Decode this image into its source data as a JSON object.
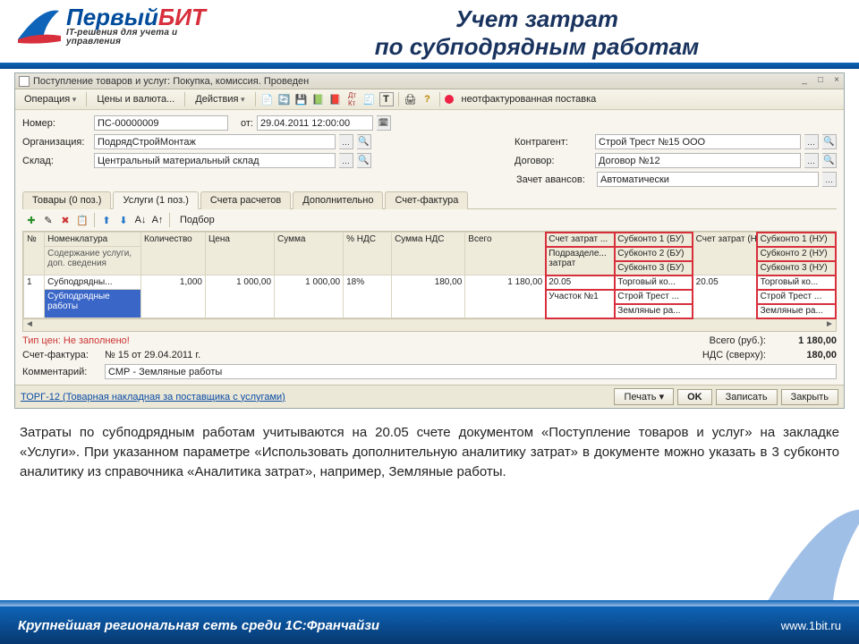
{
  "branding": {
    "logo_first": "Первый",
    "logo_bit": "БИТ",
    "logo_tagline": "IT-решения для учета и управления"
  },
  "slide": {
    "title_line1": "Учет затрат",
    "title_line2": "по субподрядным работам",
    "paragraph": "Затраты по субподрядным работам учитываются на 20.05 счете документом «Поступление товаров и услуг» на закладке «Услуги». При указанном параметре «Использовать дополнительную аналитику затрат» в документе можно указать в 3 субконто аналитику из справочника «Аналитика затрат», например, Земляные работы."
  },
  "window": {
    "title": "Поступление товаров и услуг: Покупка, комиссия. Проведен"
  },
  "toolbar": {
    "operation": "Операция",
    "prices": "Цены и валюта...",
    "actions": "Действия",
    "unbilled": "неотфактурованная поставка"
  },
  "form": {
    "number_label": "Номер:",
    "number_value": "ПС-00000009",
    "from_label": "от:",
    "from_value": "29.04.2011 12:00:00",
    "org_label": "Организация:",
    "org_value": "ПодрядСтройМонтаж",
    "warehouse_label": "Склад:",
    "warehouse_value": "Центральный материальный склад",
    "counterparty_label": "Контрагент:",
    "counterparty_value": "Строй Трест №15 ООО",
    "contract_label": "Договор:",
    "contract_value": "Договор №12",
    "advances_label": "Зачет авансов:",
    "advances_value": "Автоматически"
  },
  "tabs": [
    {
      "label": "Товары (0 поз.)"
    },
    {
      "label": "Услуги (1 поз.)"
    },
    {
      "label": "Счета расчетов"
    },
    {
      "label": "Дополнительно"
    },
    {
      "label": "Счет-фактура"
    }
  ],
  "subtoolbar": {
    "podbor": "Подбор"
  },
  "grid": {
    "headers": {
      "n": "№",
      "nomen": "Номенклатура",
      "desc": "Содержание услуги, доп. сведения",
      "qty": "Количество",
      "price": "Цена",
      "sum": "Сумма",
      "vat_pct": "% НДС",
      "vat_sum": "Сумма НДС",
      "total": "Всего",
      "cost_acct": "Счет затрат ...",
      "division": "Подразделе... затрат",
      "sub_bu1": "Субконто 1 (БУ)",
      "sub_bu2": "Субконто 2 (БУ)",
      "sub_bu3": "Субконто 3 (БУ)",
      "cost_acct_nu": "Счет затрат (НУ)",
      "sub_nu1": "Субконто 1 (НУ)",
      "sub_nu2": "Субконто 2 (НУ)",
      "sub_nu3": "Субконто 3 (НУ)"
    },
    "row": {
      "n": "1",
      "nomen": "Субподрядны...",
      "desc": "Субподрядные работы",
      "qty": "1,000",
      "price": "1 000,00",
      "sum": "1 000,00",
      "vat_pct": "18%",
      "vat_sum": "180,00",
      "total": "1 180,00",
      "cost_acct": "20.05",
      "division": "Участок №1",
      "sub_bu1": "Торговый ко...",
      "sub_bu2": "Строй Трест ...",
      "sub_bu3": "Земляные ра...",
      "cost_acct_nu": "20.05",
      "sub_nu1": "Торговый ко...",
      "sub_nu2": "Строй Трест ...",
      "sub_nu3": "Земляные ра..."
    }
  },
  "totals": {
    "price_type_label": "Тип цен: Не заполнено!",
    "invoice_label": "Счет-фактура:",
    "invoice_value": "№ 15 от 29.04.2011 г.",
    "comment_label": "Комментарий:",
    "comment_value": "СМР - Земляные работы",
    "total_label": "Всего (руб.):",
    "total_value": "1 180,00",
    "vat_label": "НДС (сверху):",
    "vat_value": "180,00"
  },
  "bottombar": {
    "torg_link": "ТОРГ-12 (Товарная накладная за поставщика с услугами)",
    "print": "Печать",
    "ok": "OK",
    "save": "Записать",
    "close": "Закрыть"
  },
  "footer": {
    "text": "Крупнейшая региональная сеть среди 1С:Франчайзи",
    "url": "www.1bit.ru"
  }
}
